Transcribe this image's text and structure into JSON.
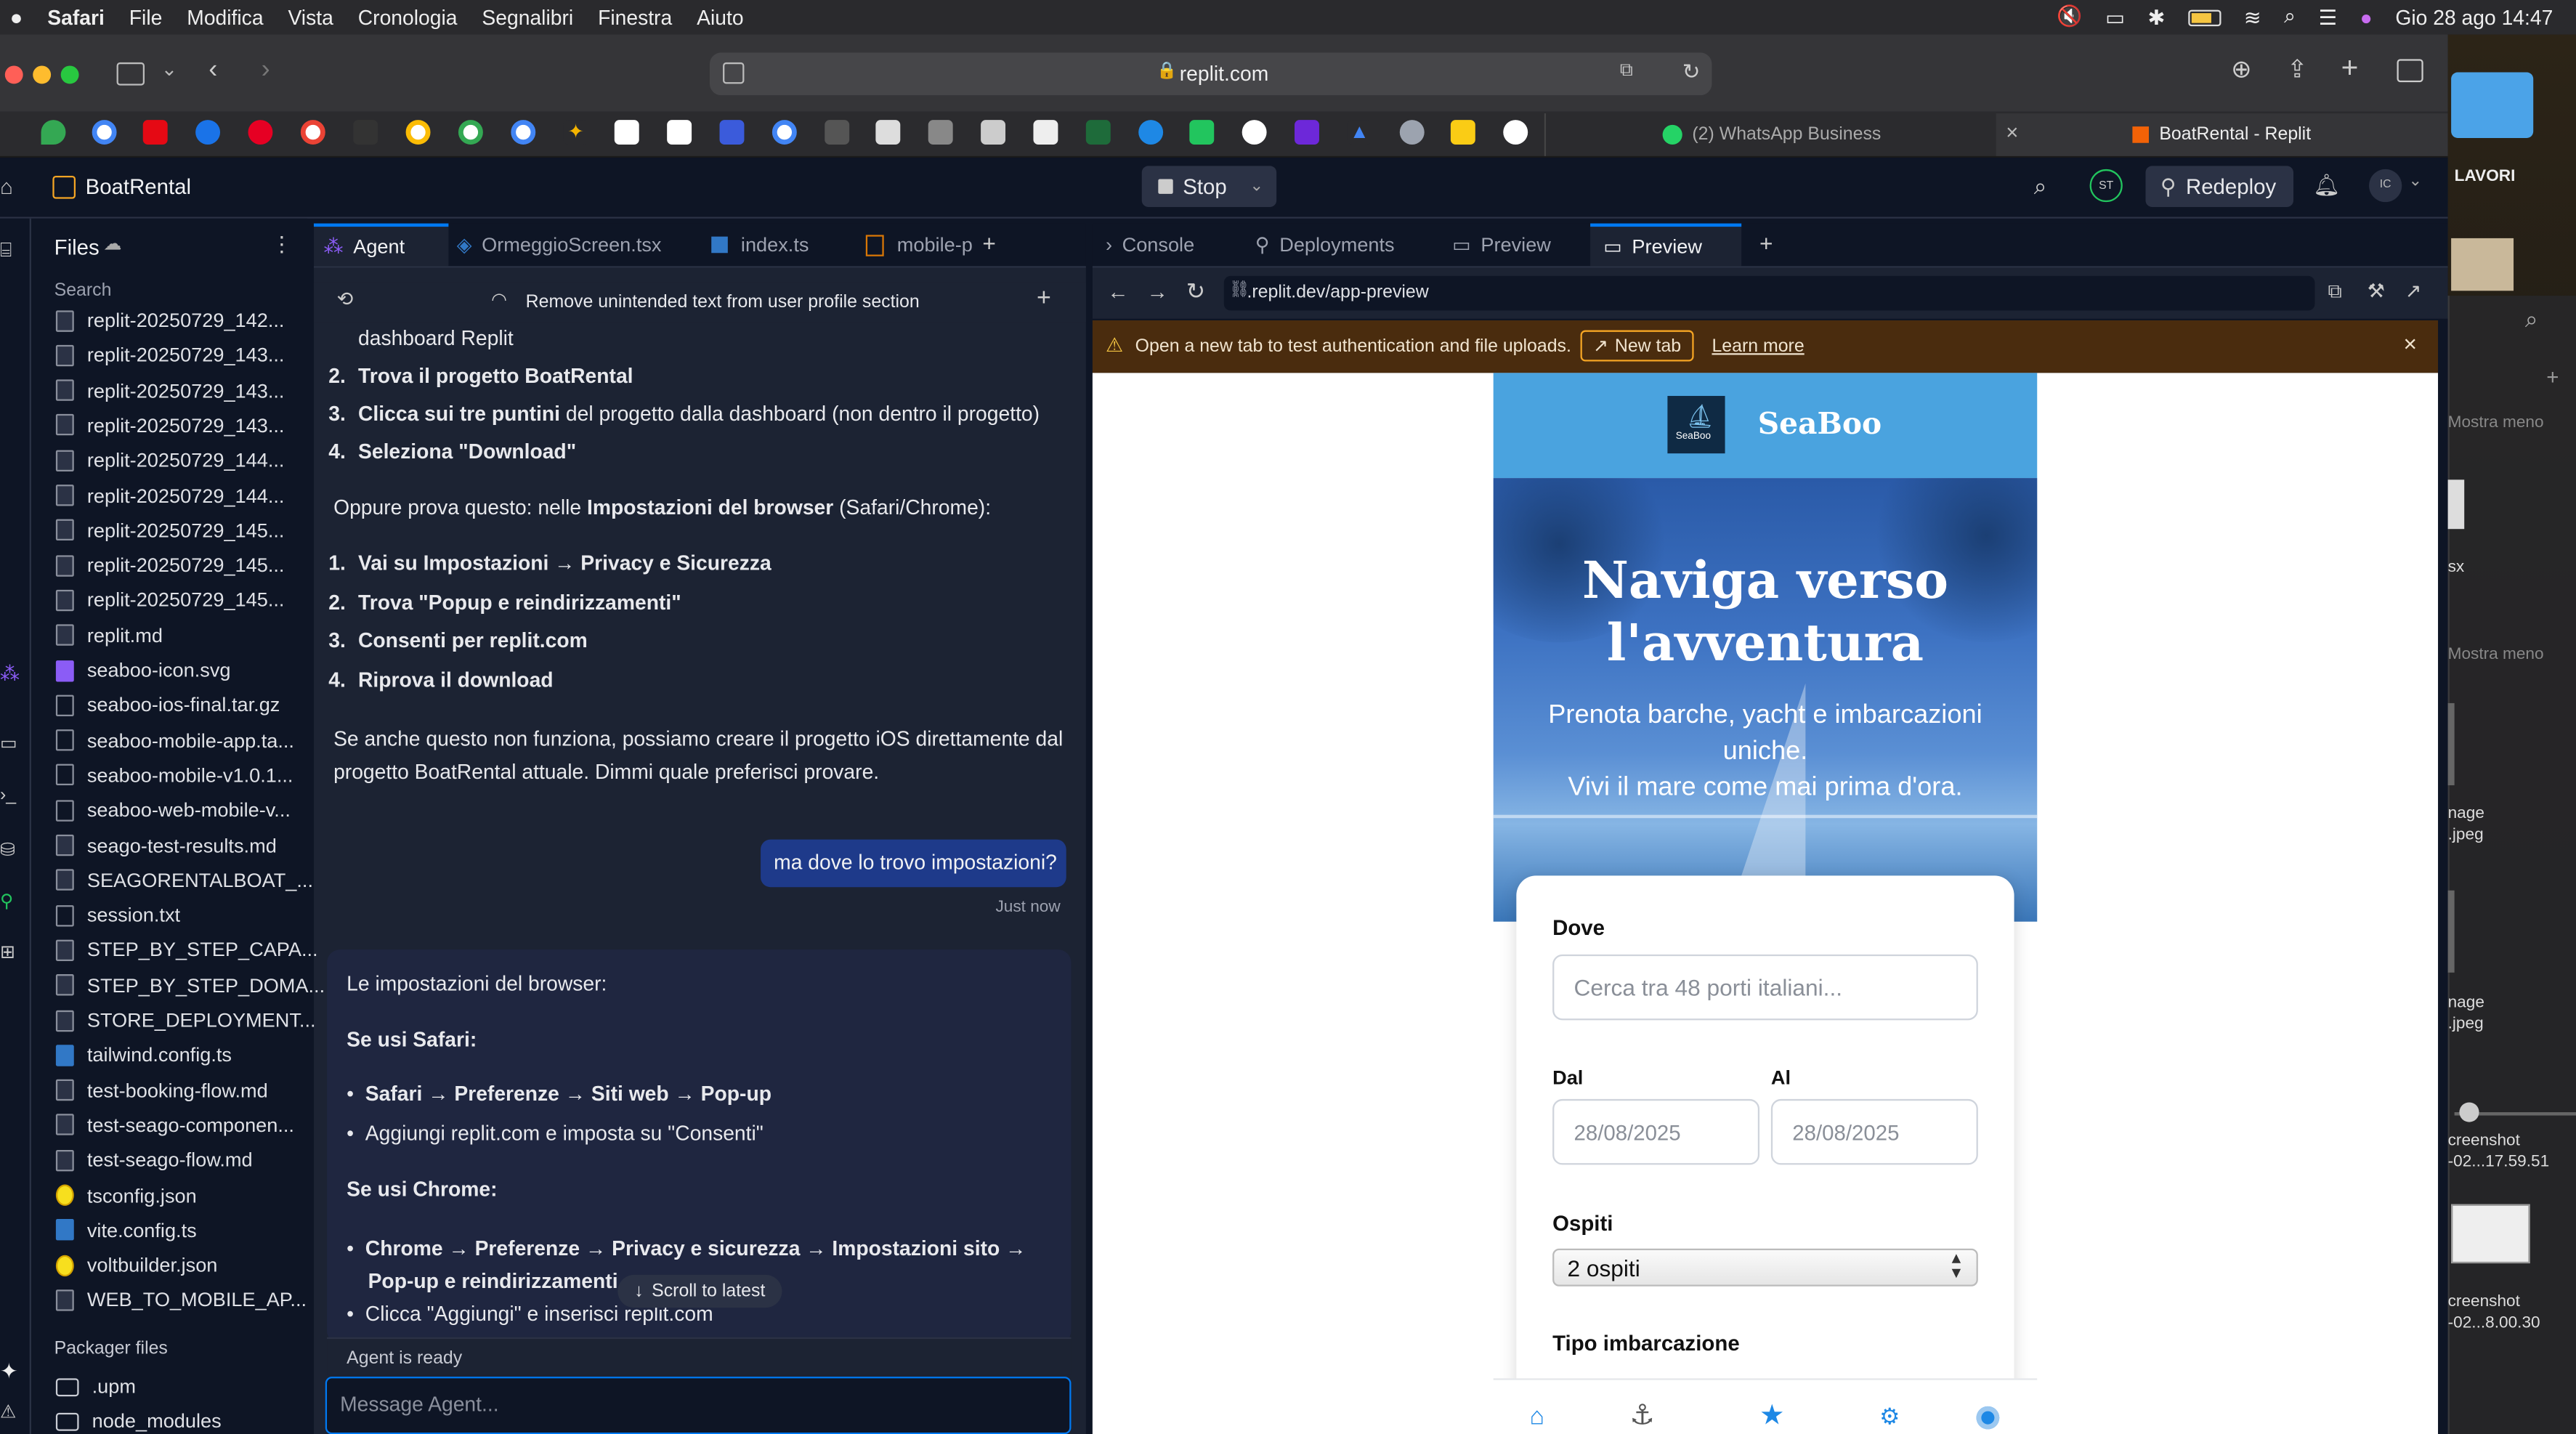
{
  "menubar": {
    "apple": "",
    "items": [
      "Safari",
      "File",
      "Modifica",
      "Vista",
      "Cronologia",
      "Segnalibri",
      "Finestra",
      "Aiuto"
    ],
    "datetime": "Gio 28 ago  14:47"
  },
  "safari": {
    "url": "replit.com",
    "tabs": [
      {
        "label": "(2) WhatsApp Business"
      },
      {
        "label": "BoatRental - Replit"
      }
    ]
  },
  "replit": {
    "project_name": "BoatRental",
    "stop_label": "Stop",
    "redeploy_label": "Redeploy",
    "avatar_st": "ST",
    "avatar_ic": "IC"
  },
  "files_panel": {
    "title": "Files",
    "search_placeholder": "Search",
    "files": [
      {
        "name": "replit-20250729_142...",
        "type": "md"
      },
      {
        "name": "replit-20250729_143...",
        "type": "md"
      },
      {
        "name": "replit-20250729_143...",
        "type": "md"
      },
      {
        "name": "replit-20250729_143...",
        "type": "md"
      },
      {
        "name": "replit-20250729_144...",
        "type": "md"
      },
      {
        "name": "replit-20250729_144...",
        "type": "md"
      },
      {
        "name": "replit-20250729_145...",
        "type": "md"
      },
      {
        "name": "replit-20250729_145...",
        "type": "md"
      },
      {
        "name": "replit-20250729_145...",
        "type": "md"
      },
      {
        "name": "replit.md",
        "type": "md"
      },
      {
        "name": "seaboo-icon.svg",
        "type": "svg"
      },
      {
        "name": "seaboo-ios-final.tar.gz",
        "type": "file"
      },
      {
        "name": "seaboo-mobile-app.ta...",
        "type": "file"
      },
      {
        "name": "seaboo-mobile-v1.0.1...",
        "type": "file"
      },
      {
        "name": "seaboo-web-mobile-v...",
        "type": "file"
      },
      {
        "name": "seago-test-results.md",
        "type": "md"
      },
      {
        "name": "SEAGORENTALBOAT_...",
        "type": "md"
      },
      {
        "name": "session.txt",
        "type": "txt"
      },
      {
        "name": "STEP_BY_STEP_CAPA...",
        "type": "md"
      },
      {
        "name": "STEP_BY_STEP_DOMA...",
        "type": "md"
      },
      {
        "name": "STORE_DEPLOYMENT...",
        "type": "md"
      },
      {
        "name": "tailwind.config.ts",
        "type": "ts"
      },
      {
        "name": "test-booking-flow.md",
        "type": "md"
      },
      {
        "name": "test-seago-componen...",
        "type": "md"
      },
      {
        "name": "test-seago-flow.md",
        "type": "md"
      },
      {
        "name": "tsconfig.json",
        "type": "json"
      },
      {
        "name": "vite.config.ts",
        "type": "ts"
      },
      {
        "name": "voltbuilder.json",
        "type": "json"
      },
      {
        "name": "WEB_TO_MOBILE_AP...",
        "type": "md"
      }
    ],
    "packager_title": "Packager files",
    "packager": [
      ".upm",
      "node_modules"
    ]
  },
  "editor_tabs": [
    "Agent",
    "OrmeggioScreen.tsx",
    "index.ts",
    "mobile-p"
  ],
  "agent": {
    "task_title": "Remove unintended text from user profile section",
    "line_top": "dashboard Replit",
    "steps1": [
      {
        "n": "2.",
        "bold": "Trova il progetto BoatRental",
        "rest": ""
      },
      {
        "n": "3.",
        "bold": "Clicca sui tre puntini",
        "rest": " del progetto dalla dashboard (non dentro il progetto)"
      },
      {
        "n": "4.",
        "bold": "Seleziona \"Download\"",
        "rest": ""
      }
    ],
    "para1_pre": "Oppure prova questo: nelle ",
    "para1_bold": "Impostazioni del browser",
    "para1_post": " (Safari/Chrome):",
    "steps2": [
      {
        "n": "1.",
        "bold": "Vai su Impostazioni → Privacy e Sicurezza"
      },
      {
        "n": "2.",
        "bold": "Trova \"Popup e reindirizzamenti\""
      },
      {
        "n": "3.",
        "bold": "Consenti per replit.com"
      },
      {
        "n": "4.",
        "bold": "Riprova il download"
      }
    ],
    "para2_l1": "Se anche questo non funziona, possiamo creare il progetto iOS direttamente dal",
    "para2_l2": "progetto BoatRental attuale. Dimmi quale preferisci provare.",
    "user_msg": "ma dove lo trovo impostazioni?",
    "user_time": "Just now",
    "reply_intro": "Le impostazioni del browser:",
    "safari_head": "Se usi Safari:",
    "safari_b1": "Safari → Preferenze → Siti web → Pop-up",
    "safari_b2": "Aggiungi replit.com e imposta su \"Consenti\"",
    "chrome_head": "Se usi Chrome:",
    "chrome_b1_l1": "Chrome → Preferenze → Privacy e sicurezza → Impostazioni sito →",
    "chrome_b1_l2": "Pop-up e reindirizzamenti",
    "chrome_b2": "Clicca \"Aggiungi\" e inserisci replit.com",
    "scroll_latest": "Scroll to latest",
    "status": "Agent is ready",
    "input_placeholder": "Message Agent..."
  },
  "right_tabs": [
    "Console",
    "Deployments",
    "Preview",
    "Preview"
  ],
  "preview": {
    "url": ".replit.dev/app-preview",
    "banner_text": "Open a new tab to test authentication and file uploads.",
    "banner_button": "New tab",
    "banner_link": "Learn more"
  },
  "app": {
    "brand": "SeaBoo",
    "logo_text": "SeaBoo",
    "hero_title_l1": "Naviga verso",
    "hero_title_l2": "l'avventura",
    "hero_sub_l1": "Prenota barche, yacht e imbarcazioni",
    "hero_sub_l2": "uniche.",
    "hero_sub_l3": "Vivi il mare come mai prima d'ora.",
    "dove_label": "Dove",
    "dove_placeholder": "Cerca tra 48 porti italiani...",
    "dal_label": "Dal",
    "al_label": "Al",
    "date_dal": "28/08/2025",
    "date_al": "28/08/2025",
    "ospiti_label": "Ospiti",
    "ospiti_value": "2 ospiti",
    "tipo_label": "Tipo imbarcazione"
  },
  "desktop_right": {
    "folder_label": "LAVORI",
    "mostra_meno_1": "Mostra meno",
    "mostra_meno_2": "Mostra meno",
    "sx": "sx",
    "img1_l1": "nage",
    "img1_l2": ".jpeg",
    "img2_l1": "nage",
    "img2_l2": ".jpeg",
    "shot1_l1": "creenshot",
    "shot1_l2": "-02...17.59.51",
    "shot2_l1": "creenshot",
    "shot2_l2": "-02...8.00.30"
  },
  "colors": {
    "accent_blue": "#0079f2",
    "app_header": "#4aa3df",
    "banner_bg": "#4a2c0e",
    "nav_active": "#1e88e5"
  }
}
